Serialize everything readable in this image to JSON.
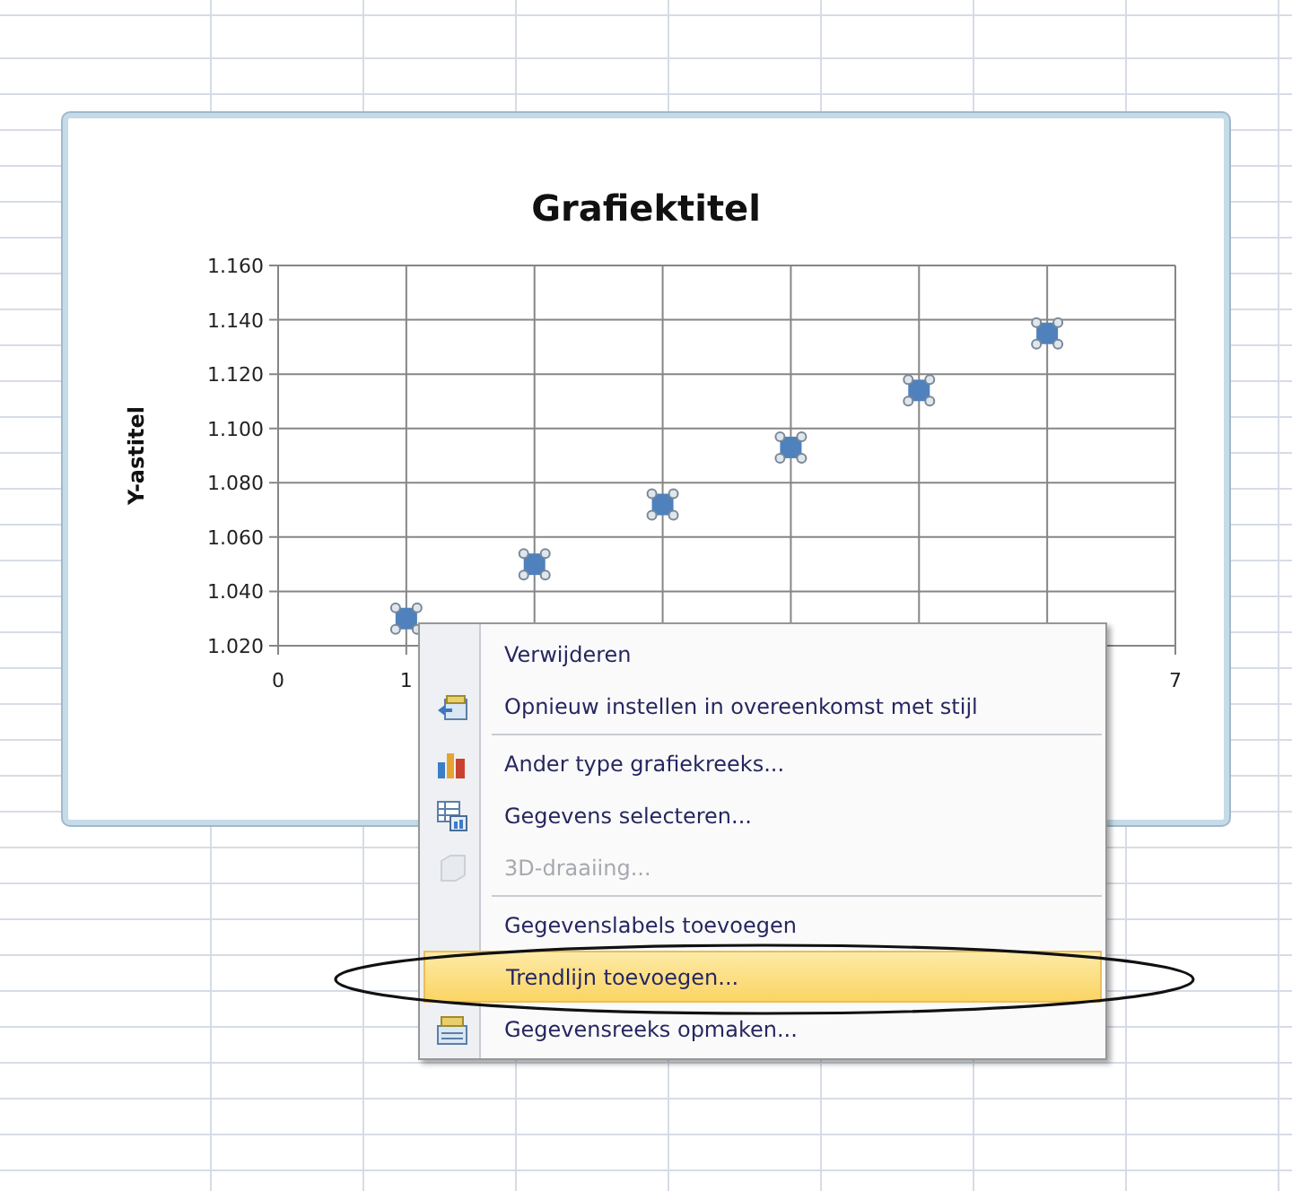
{
  "chart": {
    "chart_data": {
      "type": "scatter",
      "title": "Grafiektitel",
      "ylabel": "Y-astitel",
      "grid": true,
      "x": [
        1,
        2,
        3,
        4,
        5,
        6
      ],
      "series": [
        {
          "color": "#4f81bd",
          "values": [
            1.03,
            1.05,
            1.072,
            1.093,
            1.114,
            1.135
          ]
        }
      ],
      "xlim": [
        0,
        7
      ],
      "ylim": [
        1.02,
        1.16
      ],
      "xticks": [
        {
          "value": 0,
          "label": "0"
        },
        {
          "value": 1,
          "label": "1"
        },
        {
          "value": 7,
          "label": "7"
        }
      ],
      "yticks": [
        {
          "value": 1.02,
          "label": "1.020"
        },
        {
          "value": 1.04,
          "label": "1.040"
        },
        {
          "value": 1.06,
          "label": "1.060"
        },
        {
          "value": 1.08,
          "label": "1.080"
        },
        {
          "value": 1.1,
          "label": "1.100"
        },
        {
          "value": 1.12,
          "label": "1.120"
        },
        {
          "value": 1.14,
          "label": "1.140"
        },
        {
          "value": 1.16,
          "label": "1.160"
        }
      ]
    }
  },
  "context_menu": {
    "items": [
      {
        "kind": "item",
        "label": "Verwijderen",
        "disabled": false,
        "selected": false
      },
      {
        "kind": "item",
        "label": "Opnieuw instellen in overeenkomst met stijl",
        "disabled": false,
        "selected": false
      },
      {
        "kind": "separator"
      },
      {
        "kind": "item",
        "label": "Ander type grafiekreeks...",
        "disabled": false,
        "selected": false
      },
      {
        "kind": "item",
        "label": "Gegevens selecteren...",
        "disabled": false,
        "selected": false
      },
      {
        "kind": "item",
        "label": "3D-draaiing...",
        "disabled": true,
        "selected": false
      },
      {
        "kind": "separator"
      },
      {
        "kind": "item",
        "label": "Gegevenslabels toevoegen",
        "disabled": false,
        "selected": false
      },
      {
        "kind": "item",
        "label": "Trendlijn toevoegen...",
        "disabled": false,
        "selected": true
      },
      {
        "kind": "item",
        "label": "Gegevensreeks opmaken...",
        "disabled": false,
        "selected": false
      }
    ]
  }
}
